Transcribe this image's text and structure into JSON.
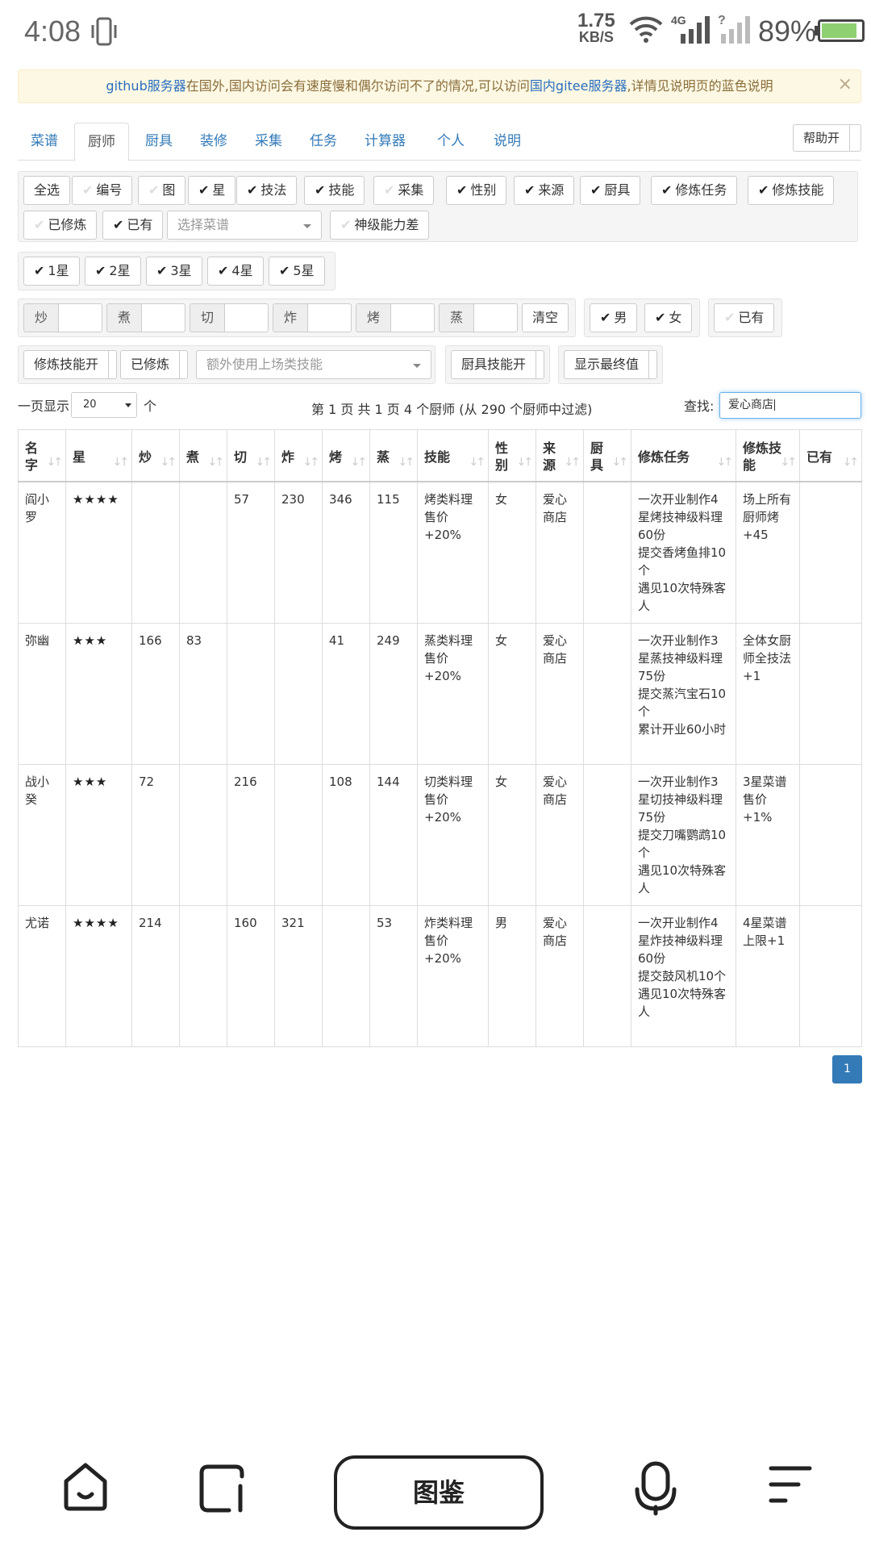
{
  "status": {
    "time": "4:08",
    "speed_value": "1.75",
    "speed_unit": "KB/S",
    "network": "4G",
    "battery": "89%",
    "battery_level": 0.89
  },
  "alert": {
    "link1": "github服务器",
    "text1": "在国外,国内访问会有速度慢和偶尔访问不了的情况,可以访问",
    "link2": "国内gitee服务器",
    "text2": ",详情见说明页的蓝色说明",
    "close": "×"
  },
  "tabs": [
    "菜谱",
    "厨师",
    "厨具",
    "装修",
    "采集",
    "任务",
    "计算器",
    "个人",
    "说明"
  ],
  "active_tab": "厨师",
  "help_button": "帮助开",
  "column_toggles": [
    {
      "label": "全选",
      "checked": null
    },
    {
      "label": "编号",
      "checked": false
    },
    {
      "label": "图",
      "checked": false
    },
    {
      "label": "星",
      "checked": true
    },
    {
      "label": "技法",
      "checked": true
    },
    {
      "label": "技能",
      "checked": true
    },
    {
      "label": "采集",
      "checked": false
    },
    {
      "label": "性别",
      "checked": true
    },
    {
      "label": "来源",
      "checked": true
    },
    {
      "label": "厨具",
      "checked": true
    },
    {
      "label": "修炼任务",
      "checked": true
    },
    {
      "label": "修炼技能",
      "checked": true
    },
    {
      "label": "已修炼",
      "checked": false
    },
    {
      "label": "已有",
      "checked": true
    }
  ],
  "recipe_select_placeholder": "选择菜谱",
  "god_ability_toggle": "神级能力差",
  "star_filters": [
    "1星",
    "2星",
    "3星",
    "4星",
    "5星"
  ],
  "skill_inputs": [
    "炒",
    "煮",
    "切",
    "炸",
    "烤",
    "蒸"
  ],
  "clear_button": "清空",
  "gender_filters": [
    "男",
    "女"
  ],
  "owned_filter": "已有",
  "train_skill_toggle": "修炼技能开",
  "trained_toggle": "已修炼",
  "extra_skill_placeholder": "额外使用上场类技能",
  "equip_skill_toggle": "厨具技能开",
  "final_value_toggle": "显示最终值",
  "table_controls": {
    "length_prefix": "一页显示",
    "length_value": "20",
    "length_suffix": "个",
    "info": "第 1 页 共 1 页 4 个厨师 (从 290 个厨师中过滤)",
    "search_label": "查找:",
    "search_value": "爱心商店"
  },
  "table": {
    "headers": [
      "名字",
      "星",
      "炒",
      "煮",
      "切",
      "炸",
      "烤",
      "蒸",
      "技能",
      "性别",
      "来源",
      "厨具",
      "修炼任务",
      "修炼技能",
      "已有"
    ],
    "rows": [
      {
        "name": "阎小罗",
        "stars": "★★★★",
        "stir": "",
        "boil": "",
        "cut": "57",
        "fry": "230",
        "roast": "346",
        "steam": "115",
        "skill": "烤类料理售价+20%",
        "gender": "女",
        "source": "爱心商店",
        "equip": "",
        "task": "一次开业制作4星烤技神级料理60份\n提交香烤鱼排10个\n遇见10次特殊客人",
        "train_skill": "场上所有厨师烤+45",
        "owned": ""
      },
      {
        "name": "弥幽",
        "stars": "★★★",
        "stir": "166",
        "boil": "83",
        "cut": "",
        "fry": "",
        "roast": "41",
        "steam": "249",
        "skill": "蒸类料理售价+20%",
        "gender": "女",
        "source": "爱心商店",
        "equip": "",
        "task": "一次开业制作3星蒸技神级料理75份\n提交蒸汽宝石10个\n累计开业60小时",
        "train_skill": "全体女厨师全技法+1",
        "owned": ""
      },
      {
        "name": "战小癸",
        "stars": "★★★",
        "stir": "72",
        "boil": "",
        "cut": "216",
        "fry": "",
        "roast": "108",
        "steam": "144",
        "skill": "切类料理售价+20%",
        "gender": "女",
        "source": "爱心商店",
        "equip": "",
        "task": "一次开业制作3星切技神级料理75份\n提交刀嘴鹦鹉10个\n遇见10次特殊客人",
        "train_skill": "3星菜谱售价+1%",
        "owned": ""
      },
      {
        "name": "尤诺",
        "stars": "★★★★",
        "stir": "214",
        "boil": "",
        "cut": "160",
        "fry": "321",
        "roast": "",
        "steam": "53",
        "skill": "炸类料理售价+20%",
        "gender": "男",
        "source": "爱心商店",
        "equip": "",
        "task": "一次开业制作4星炸技神级料理60份\n提交鼓风机10个\n遇见10次特殊客人",
        "train_skill": "4星菜谱上限+1",
        "owned": ""
      }
    ]
  },
  "pagination": {
    "current": "1"
  },
  "bottom_nav": {
    "center_label": "图鉴"
  },
  "colors": {
    "link": "#337ab7",
    "alert_bg": "#fcf8e3",
    "alert_text": "#8a6d3b",
    "primary": "#337ab7",
    "battery": "#8ed072"
  }
}
